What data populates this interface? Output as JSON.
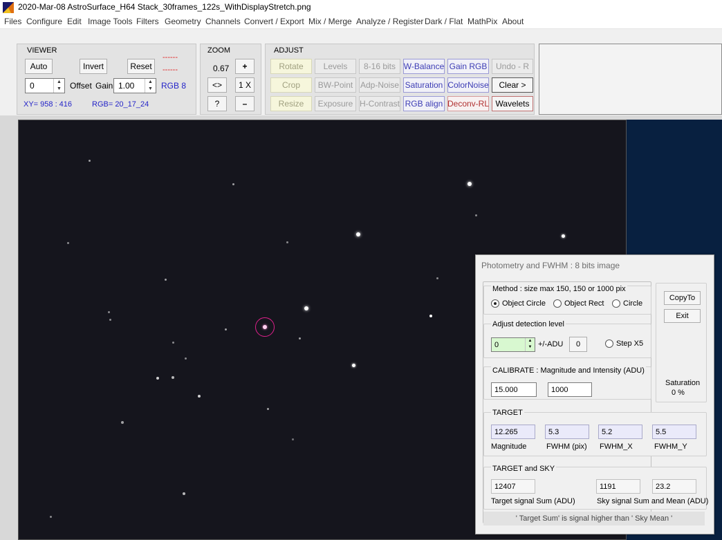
{
  "window": {
    "title": "2020-Mar-08  AstroSurface_H64     Stack_30frames_122s_WithDisplayStretch.png",
    "icon": "astrosurface-app-icon"
  },
  "menu": [
    "Files",
    "Configure",
    "Edit",
    "Image Tools",
    "Filters",
    "Geometry",
    "Channels",
    "Convert / Export",
    "Mix / Merge",
    "Analyze / Register",
    "Dark / Flat",
    "MathPix",
    "About"
  ],
  "viewer": {
    "title": "VIEWER",
    "auto_label": "Auto",
    "invert_label": "Invert",
    "reset_label": "Reset",
    "red_dash_1": "------",
    "red_dash_2": "------",
    "offset_value": "0",
    "offset_label": "Offset",
    "gain_label": "Gain",
    "gain_value": "1.00",
    "mode_label": "RGB 8",
    "xy_text": "XY=  958 : 416",
    "rgb_text": "RGB=  20_17_24"
  },
  "zoom": {
    "title": "ZOOM",
    "value": "0.67",
    "plus_label": "+",
    "fit_label": "<>",
    "onex_label": "1 X",
    "help_label": "?",
    "minus_label": "–"
  },
  "adjust": {
    "title": "ADJUST",
    "buttons": {
      "rotate": "Rotate",
      "levels": "Levels",
      "bits": "8-16 bits",
      "wbalance": "W-Balance",
      "gainrgb": "Gain RGB",
      "undo": "Undo - R",
      "crop": "Crop",
      "bwpoint": "BW-Point",
      "adpnoise": "Adp-Noise",
      "saturation": "Saturation",
      "colornoise": "ColorNoise",
      "clear": "Clear >",
      "resize": "Resize",
      "exposure": "Exposure",
      "hcontrast": "H-Contrast",
      "rgbalign": "RGB align",
      "deconv": "Deconv-RL",
      "wavelets": "Wavelets"
    }
  },
  "photometry": {
    "title": "Photometry and FWHM : 8 bits image",
    "method_label": "Method :   size max 150, 150 or 1000 pix",
    "radio_object_circle": "Object Circle",
    "radio_object_rect": "Object Rect",
    "radio_circle": "Circle",
    "copyto_label": "CopyTo",
    "exit_label": "Exit",
    "detection_label": "Adjust detection level",
    "detection_value": "0",
    "adu_label": "+/-ADU",
    "zero_button": "0",
    "step_label": "Step X5",
    "saturation_label": "Saturation",
    "saturation_value": "0 %",
    "calibrate_label": "CALIBRATE :   Magnitude and  Intensity (ADU)",
    "cal_magnitude": "15.000",
    "cal_intensity": "1000",
    "target_label": "TARGET",
    "magnitude": "12.265",
    "fwhm": "5.3",
    "fwhm_x": "5.2",
    "fwhm_y": "5.5",
    "magnitude_label": "Magnitude",
    "fwhm_label": "FWHM (pix)",
    "fwhm_x_label": "FWHM_X",
    "fwhm_y_label": "FWHM_Y",
    "target_sky_label": "TARGET and SKY",
    "target_sum": "12407",
    "sky_sum": "1191",
    "sky_mean": "23.2",
    "target_sum_label": "Target signal Sum (ADU)",
    "sky_label": "Sky signal Sum and Mean (ADU)",
    "footer_note": "' Target Sum'  is  signal higher than  ' Sky Mean '"
  },
  "colors": {
    "accent_blue": "#2323c8",
    "red": "#e02020",
    "selection_circle": "#e0208c",
    "sky_background": "#15151d"
  }
}
